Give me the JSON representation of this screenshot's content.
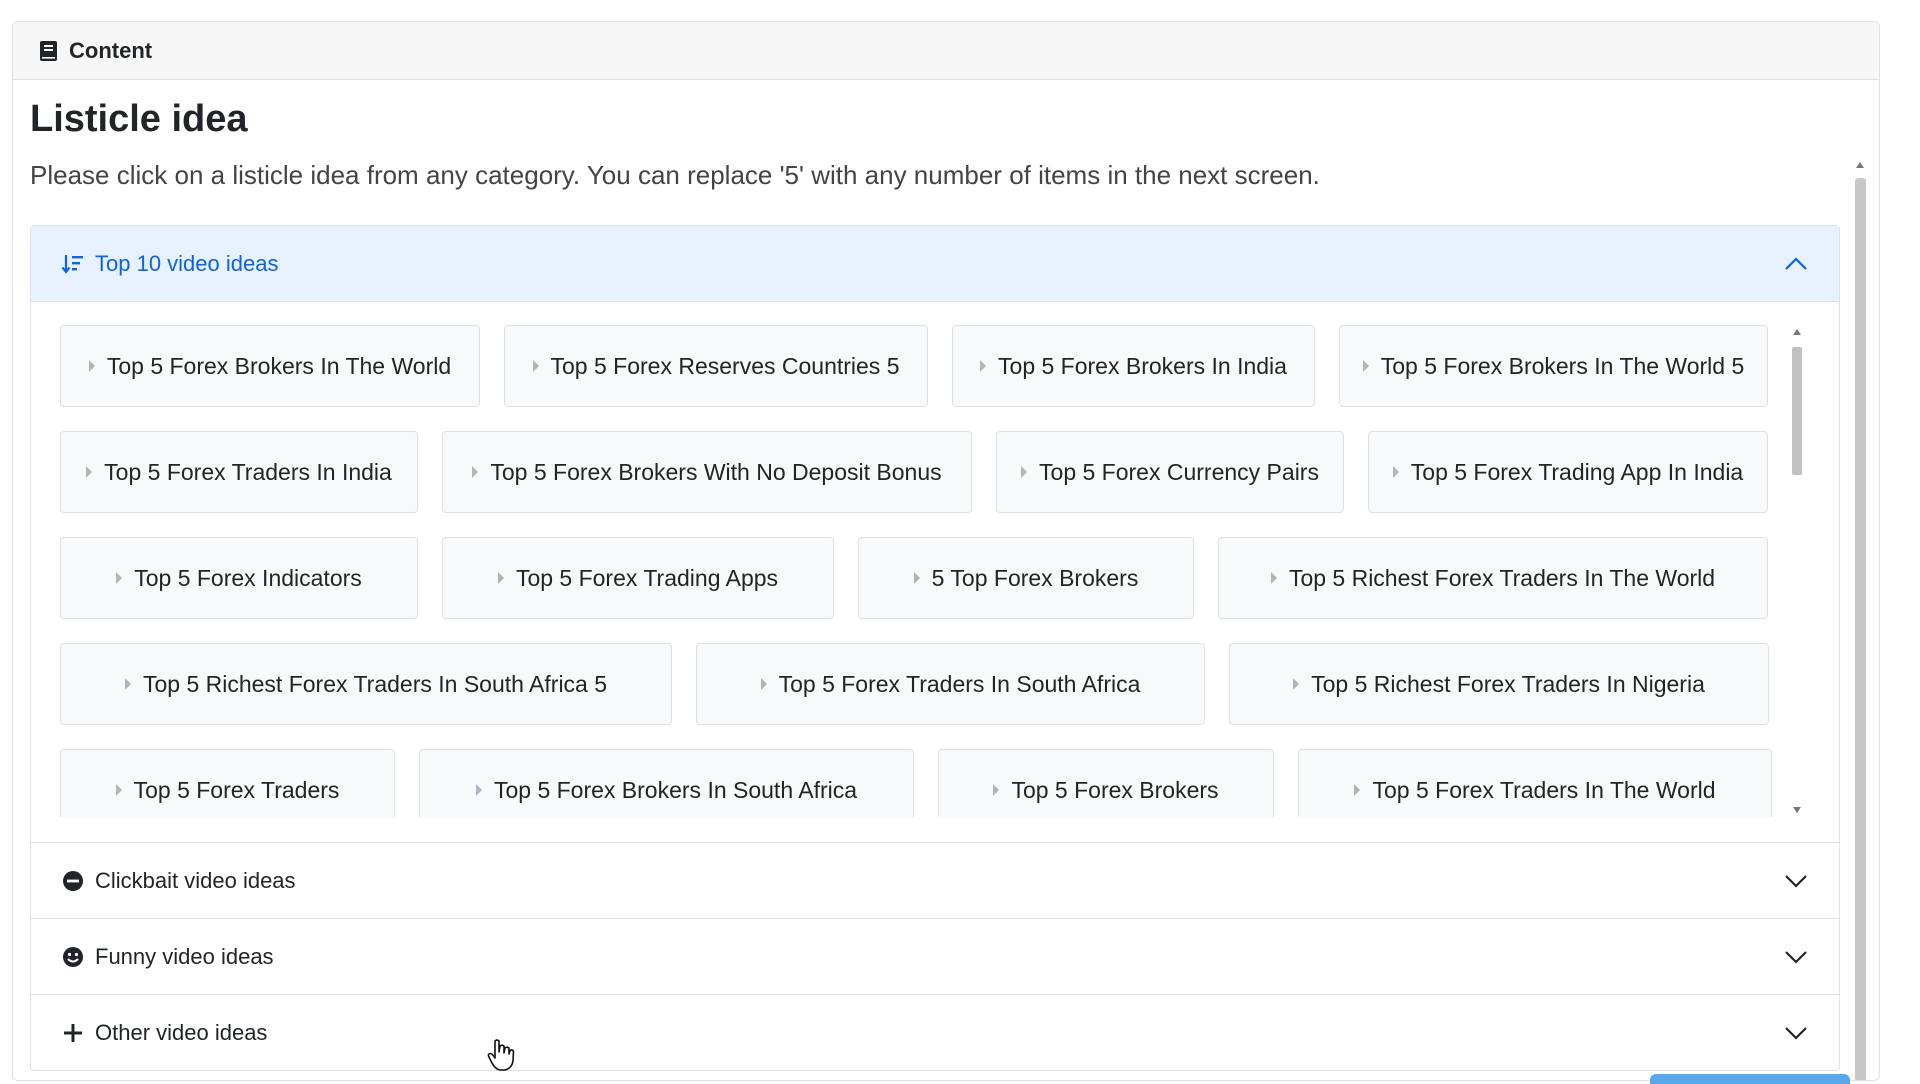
{
  "header": {
    "title": "Content",
    "icon": "book-icon"
  },
  "page": {
    "title": "Listicle idea",
    "description": "Please click on a listicle idea from any category. You can replace '5' with any number of items in the next screen."
  },
  "colors": {
    "accent": "#0c63e4",
    "active_header_bg": "#e7f1ff",
    "border": "#dee2e6",
    "card_bg": "#f8f9fa"
  },
  "accordion": {
    "sections": [
      {
        "label": "Top 10 video ideas",
        "icon": "sort-icon",
        "expanded": true
      },
      {
        "label": "Clickbait video ideas",
        "icon": "minus-circle-icon",
        "expanded": false
      },
      {
        "label": "Funny video ideas",
        "icon": "smiley-icon",
        "expanded": false
      },
      {
        "label": "Other video ideas",
        "icon": "plus-icon",
        "expanded": false
      }
    ],
    "ideas": [
      [
        "Top 5 Forex Brokers In The World",
        "Top 5 Forex Reserves Countries 5",
        "Top 5 Forex Brokers In India",
        "Top 5 Forex Brokers In The World 5"
      ],
      [
        "Top 5 Forex Traders In India",
        "Top 5 Forex Brokers With No Deposit Bonus",
        "Top 5 Forex Currency Pairs",
        "Top 5 Forex Trading App In India"
      ],
      [
        "Top 5 Forex Indicators",
        "Top 5 Forex Trading Apps",
        "5 Top Forex Brokers",
        "Top 5 Richest Forex Traders In The World"
      ],
      [
        "Top 5 Richest Forex Traders In South Africa 5",
        "Top 5 Forex Traders In South Africa",
        "Top 5 Richest Forex Traders In Nigeria"
      ],
      [
        "Top 5 Forex Traders",
        "Top 5 Forex Brokers In South Africa",
        "Top 5 Forex Brokers",
        "Top 5 Forex Traders In The World"
      ]
    ]
  }
}
